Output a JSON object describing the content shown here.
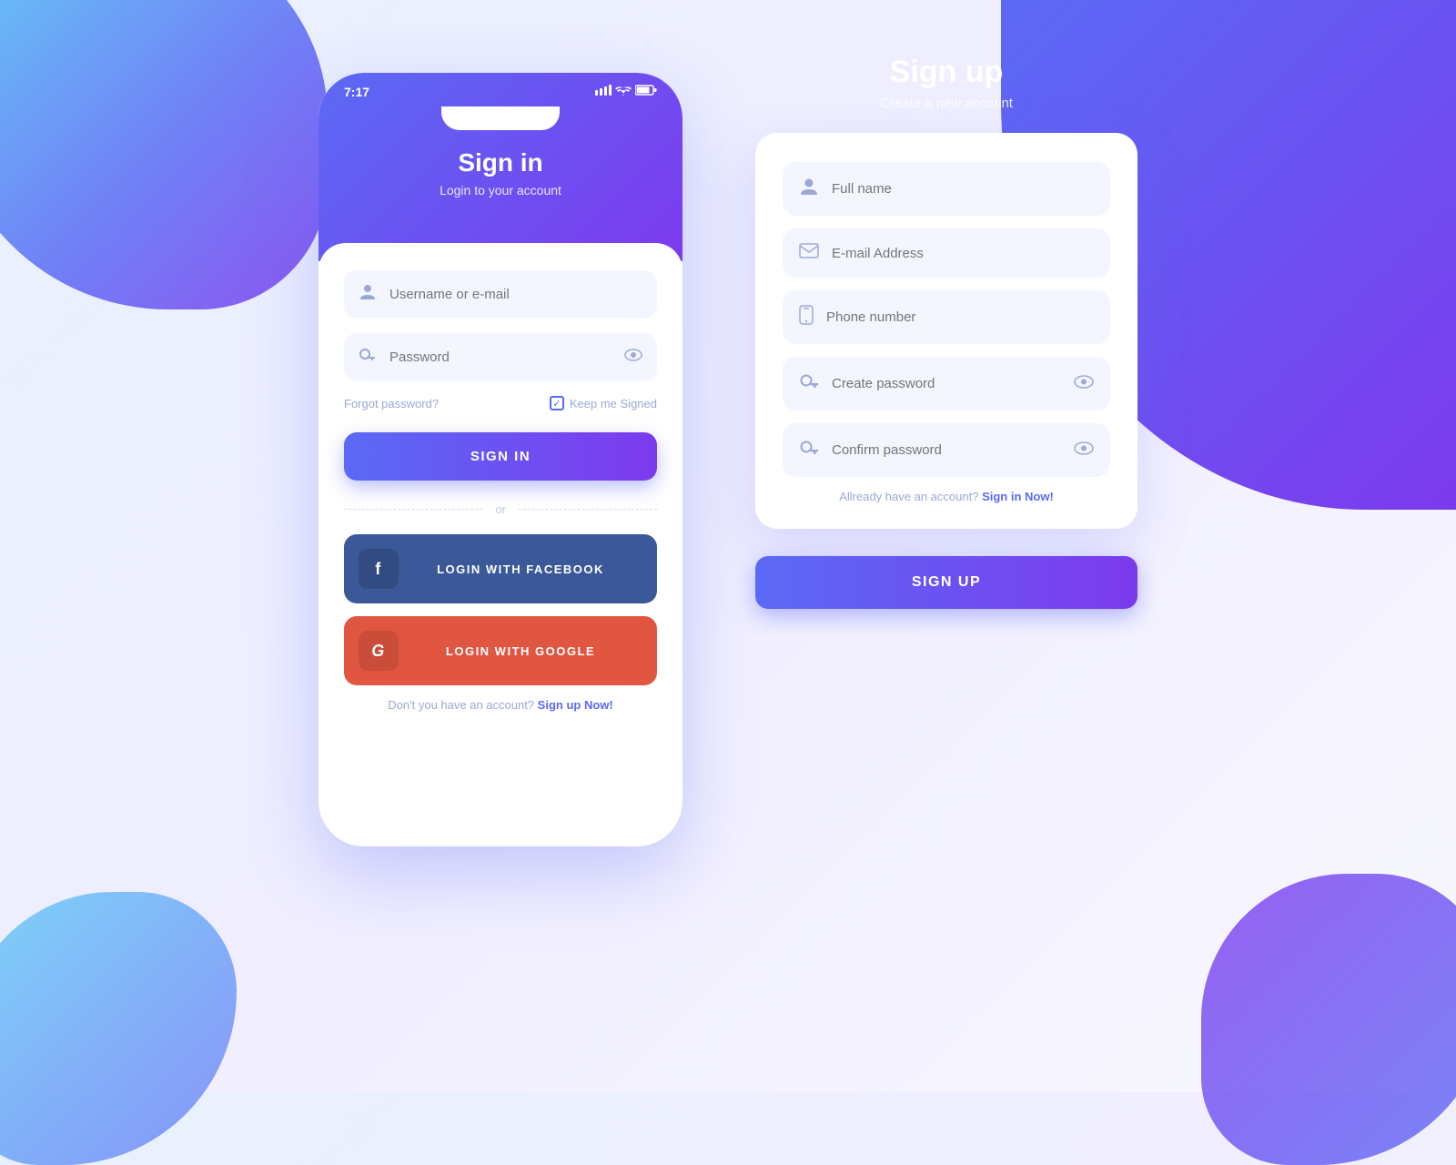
{
  "background": {
    "accent_color": "#5b6af5",
    "gradient_start": "#4dc8f5",
    "gradient_end": "#7c3aed"
  },
  "phone": {
    "status_bar": {
      "time": "7:17",
      "signal_icon": "▋▋▋",
      "wifi_icon": "WiFi",
      "battery_icon": "🔋"
    },
    "header": {
      "title": "Sign in",
      "subtitle": "Login to your account"
    },
    "form": {
      "username_placeholder": "Username or e-mail",
      "password_placeholder": "Password",
      "forgot_password_label": "Forgot password?",
      "keep_signed_label": "Keep me Signed"
    },
    "sign_in_button": "SIGN IN",
    "or_label": "or",
    "facebook_button": "LOGIN WITH FACEBOOK",
    "facebook_icon": "f",
    "google_button": "LOGIN WITH GOOGLE",
    "google_icon": "G",
    "footer_text": "Don't you have an account?",
    "footer_link": "Sign up Now!"
  },
  "signup": {
    "title": "Sign up",
    "subtitle": "Create a new account",
    "full_name_placeholder": "Full name",
    "email_placeholder": "E-mail Address",
    "phone_placeholder": "Phone number",
    "password_placeholder": "Create password",
    "confirm_password_placeholder": "Confirm password",
    "already_text": "Allready have an account?",
    "already_link": "Sign in Now!",
    "button": "SIGN UP"
  },
  "icons": {
    "user": "👤",
    "email": "✉",
    "phone": "📱",
    "key": "🔑",
    "eye": "👁",
    "check": "✓"
  }
}
